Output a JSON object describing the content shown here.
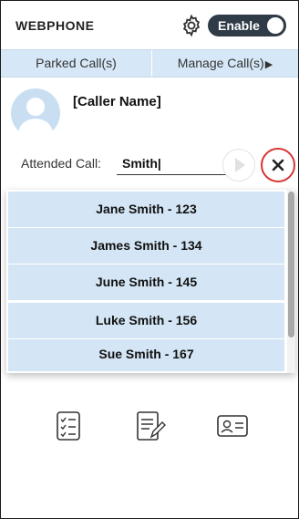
{
  "header": {
    "title": "WEBPHONE",
    "settings_icon": "gear-icon",
    "toggle_label": "Enable"
  },
  "tabs": [
    {
      "label": "Parked Call(s)"
    },
    {
      "label": "Manage Call(s)",
      "icon": "triangle-right-icon"
    }
  ],
  "caller": {
    "avatar_icon": "person-avatar-icon",
    "name": "[Caller Name]"
  },
  "attended_call": {
    "label": "Attended Call:",
    "value": "Smith|",
    "play_icon": "play-icon",
    "cancel_icon": "close-icon"
  },
  "suggestions": [
    "Jane Smith - 123",
    "James Smith - 134",
    "June Smith - 145",
    "Luke Smith - 156",
    "Sue Smith - 167"
  ],
  "bottom_icons": [
    "checklist-icon",
    "edit-note-icon",
    "contact-card-icon"
  ],
  "colors": {
    "accent_dark": "#2f3b47",
    "tab_bg": "#d6e8f7",
    "avatar_bg": "#c9dff1",
    "option_bg": "#d4e6f5",
    "cancel_red": "#d93434"
  }
}
